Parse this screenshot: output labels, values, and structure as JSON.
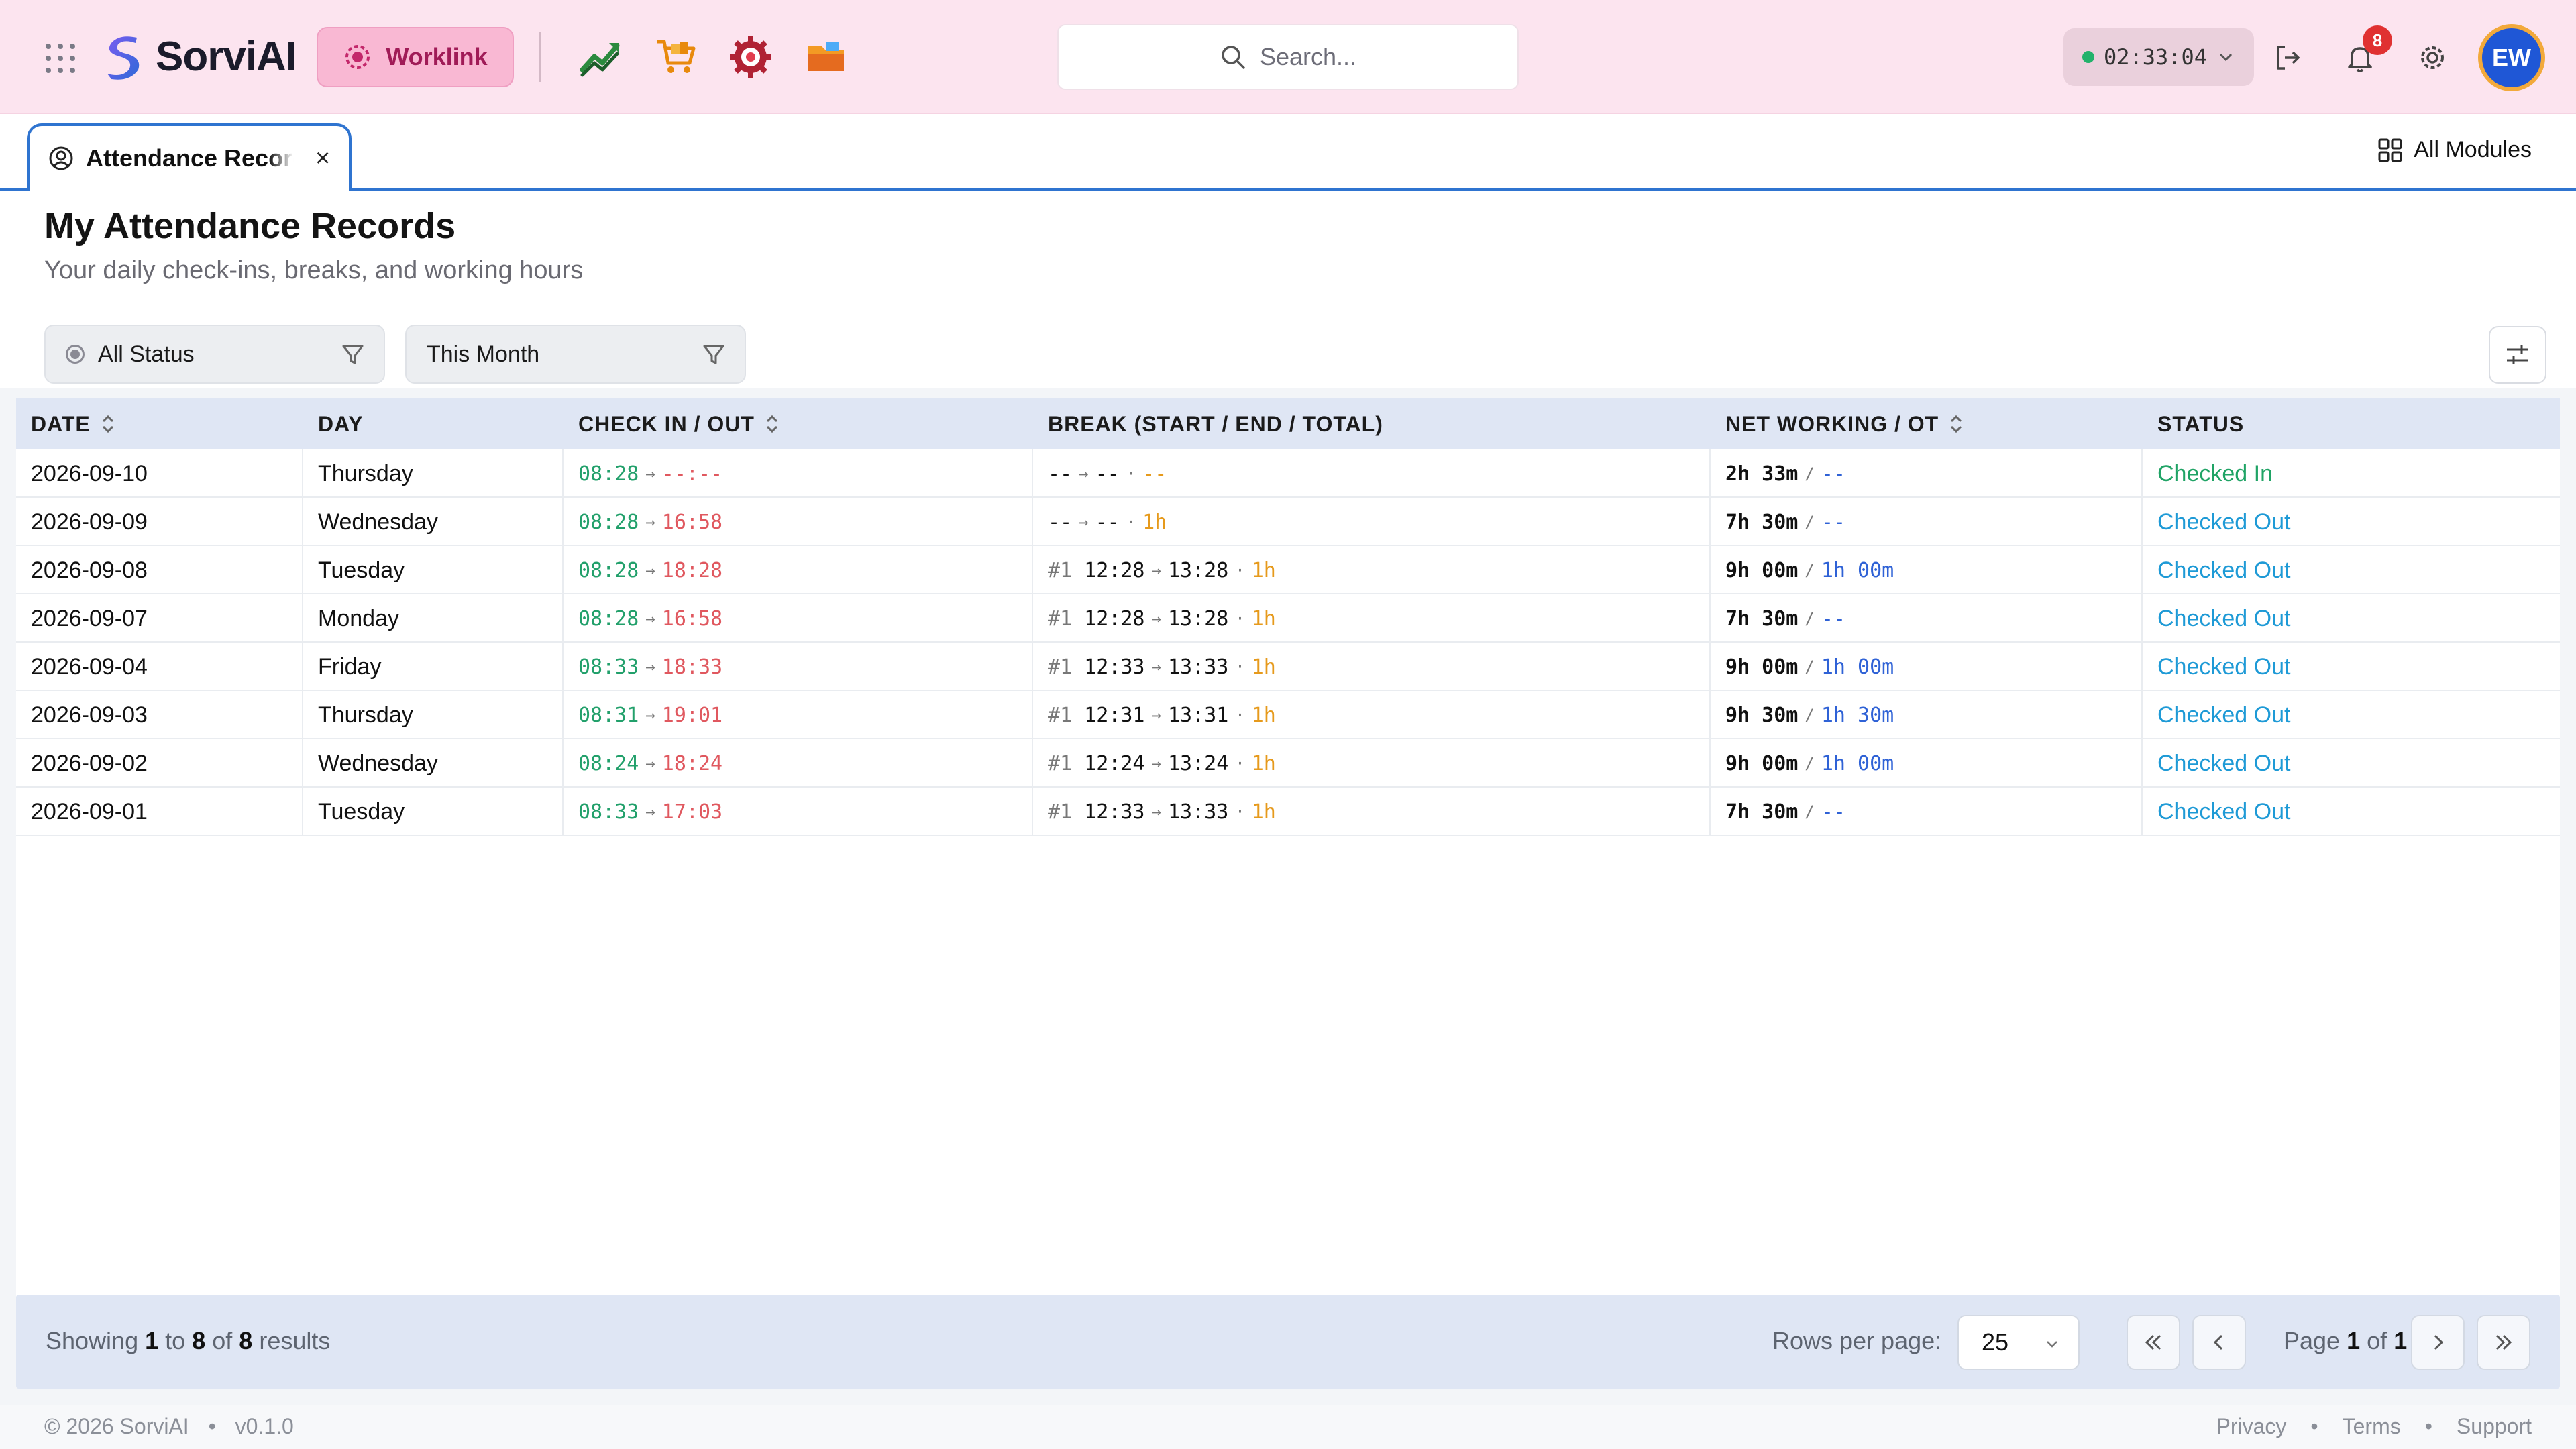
{
  "header": {
    "app_name": "SorviAI",
    "worklink_label": "Worklink",
    "search_placeholder": "Search...",
    "timer": "02:33:04",
    "notification_count": "8",
    "avatar_initials": "EW",
    "app_icons": [
      "trending-up-icon",
      "shopping-cart-icon",
      "gear-target-icon",
      "folder-icon"
    ]
  },
  "tabs": [
    {
      "label": "Attendance Records",
      "icon": "user-circle-icon",
      "active": true
    }
  ],
  "all_modules_label": "All Modules",
  "page": {
    "title": "My Attendance Records",
    "subtitle": "Your daily check-ins, breaks, and working hours"
  },
  "filters": {
    "status": "All Status",
    "period": "This Month"
  },
  "table": {
    "columns": [
      "DATE",
      "DAY",
      "CHECK IN / OUT",
      "BREAK (START / END / TOTAL)",
      "NET WORKING / OT",
      "STATUS"
    ],
    "rows": [
      {
        "date": "2026-09-10",
        "day": "Thursday",
        "check_in": "08:28",
        "check_out": "--:--",
        "break_no": "",
        "break_start": "--",
        "break_end": "--",
        "break_total": "--",
        "net": "2h 33m",
        "ot": "--",
        "status": "Checked In"
      },
      {
        "date": "2026-09-09",
        "day": "Wednesday",
        "check_in": "08:28",
        "check_out": "16:58",
        "break_no": "",
        "break_start": "--",
        "break_end": "--",
        "break_total": "1h",
        "net": "7h 30m",
        "ot": "--",
        "status": "Checked Out"
      },
      {
        "date": "2026-09-08",
        "day": "Tuesday",
        "check_in": "08:28",
        "check_out": "18:28",
        "break_no": "#1",
        "break_start": "12:28",
        "break_end": "13:28",
        "break_total": "1h",
        "net": "9h 00m",
        "ot": "1h 00m",
        "status": "Checked Out"
      },
      {
        "date": "2026-09-07",
        "day": "Monday",
        "check_in": "08:28",
        "check_out": "16:58",
        "break_no": "#1",
        "break_start": "12:28",
        "break_end": "13:28",
        "break_total": "1h",
        "net": "7h 30m",
        "ot": "--",
        "status": "Checked Out"
      },
      {
        "date": "2026-09-04",
        "day": "Friday",
        "check_in": "08:33",
        "check_out": "18:33",
        "break_no": "#1",
        "break_start": "12:33",
        "break_end": "13:33",
        "break_total": "1h",
        "net": "9h 00m",
        "ot": "1h 00m",
        "status": "Checked Out"
      },
      {
        "date": "2026-09-03",
        "day": "Thursday",
        "check_in": "08:31",
        "check_out": "19:01",
        "break_no": "#1",
        "break_start": "12:31",
        "break_end": "13:31",
        "break_total": "1h",
        "net": "9h 30m",
        "ot": "1h 30m",
        "status": "Checked Out"
      },
      {
        "date": "2026-09-02",
        "day": "Wednesday",
        "check_in": "08:24",
        "check_out": "18:24",
        "break_no": "#1",
        "break_start": "12:24",
        "break_end": "13:24",
        "break_total": "1h",
        "net": "9h 00m",
        "ot": "1h 00m",
        "status": "Checked Out"
      },
      {
        "date": "2026-09-01",
        "day": "Tuesday",
        "check_in": "08:33",
        "check_out": "17:03",
        "break_no": "#1",
        "break_start": "12:33",
        "break_end": "13:33",
        "break_total": "1h",
        "net": "7h 30m",
        "ot": "--",
        "status": "Checked Out"
      }
    ]
  },
  "pagination": {
    "showing_prefix": "Showing",
    "from": "1",
    "to_word": "to",
    "to": "8",
    "of_word": "of",
    "total": "8",
    "results_word": "results",
    "rows_per_page_label": "Rows per page:",
    "rows_per_page": "25",
    "page_word": "Page",
    "page": "1",
    "page_of": "of",
    "page_total": "1"
  },
  "footer": {
    "copyright": "© 2026 SorviAI",
    "version": "v0.1.0",
    "links": [
      "Privacy",
      "Terms",
      "Support"
    ]
  },
  "colors": {
    "header_bg": "#fce4ef",
    "accent": "#2f74d0",
    "check_in": "#22a06b",
    "check_out": "#e0585f",
    "status_in": "#1fa365",
    "status_out": "#1e9ad6",
    "ot": "#2f62d6",
    "break_total": "#e69a1c"
  }
}
